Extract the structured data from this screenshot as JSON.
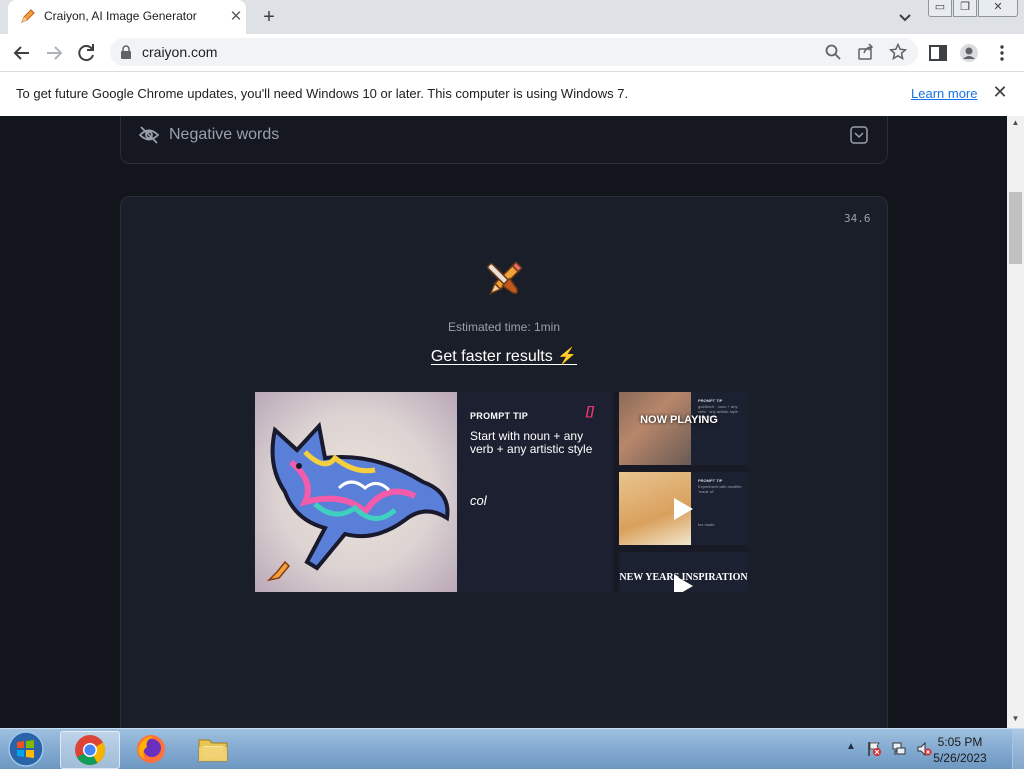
{
  "browser": {
    "tab_title": "Craiyon, AI Image Generator",
    "new_tab_symbol": "+",
    "url": "craiyon.com",
    "window_controls": {
      "minimize": "▭",
      "maximize": "❐",
      "close": "✕"
    },
    "icons": [
      "pencil-favicon",
      "back-arrow",
      "forward-arrow",
      "reload",
      "lock",
      "search",
      "share",
      "star",
      "side-panel",
      "profile",
      "kebab-menu"
    ]
  },
  "infobar": {
    "message": "To get future Google Chrome updates, you'll need Windows 10 or later. This computer is using Windows 7.",
    "link": "Learn more",
    "close": "✕"
  },
  "page": {
    "negative_words_label": "Negative words",
    "timer": "34.6",
    "estimated_time": "Estimated time: 1min",
    "faster_link": "Get faster results ⚡",
    "video": {
      "tip_title": "PROMPT TIP",
      "tip_mark": "[]",
      "tip_text": "Start with noun + any verb + any artistic style",
      "tip_example": "col",
      "thumb1_overlay": "NOW PLAYING",
      "thumb1_title": "PROMPT TIP",
      "thumb1_text": "goldfinch · noun + any verb · any artistic style · Bohemian",
      "thumb2_title": "PROMPT TIP",
      "thumb2_text": "Experiment with modifier 'made of'",
      "thumb2_caption": "fox made",
      "thumb3_text": "NEW YEARS INSPIRATION"
    }
  },
  "taskbar": {
    "clock_time": "5:05 PM",
    "clock_date": "5/26/2023",
    "apps": [
      "windows-start",
      "chrome",
      "firefox",
      "file-explorer"
    ]
  },
  "colors": {
    "page_bg": "#13151c",
    "panel_bg": "#1a1e28",
    "link_blue": "#1a73e8",
    "tip_accent": "#e8366f"
  }
}
